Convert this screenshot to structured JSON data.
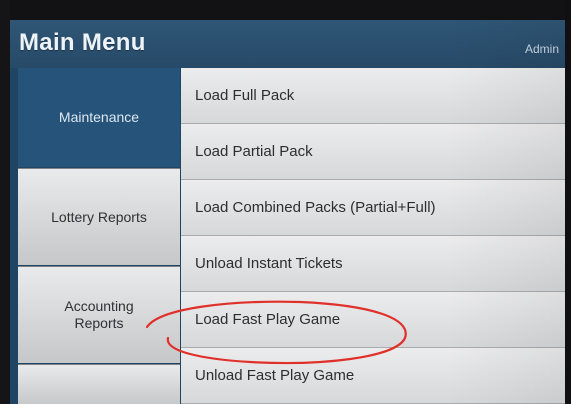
{
  "header": {
    "title": "Main Menu",
    "user": "Admin"
  },
  "sidebar": {
    "tabs": [
      {
        "label": "Maintenance",
        "active": true
      },
      {
        "label": "Lottery Reports",
        "active": false
      },
      {
        "label": "Accounting Reports",
        "active": false
      },
      {
        "label": "",
        "active": false
      }
    ]
  },
  "menu": {
    "items": [
      {
        "label": "Load Full Pack"
      },
      {
        "label": "Load Partial Pack"
      },
      {
        "label": "Load Combined Packs (Partial+Full)"
      },
      {
        "label": "Unload Instant Tickets"
      },
      {
        "label": "Load Fast Play Game",
        "circled": true
      },
      {
        "label": "Unload Fast Play Game"
      }
    ]
  },
  "colors": {
    "header_bg": "#2b5070",
    "sidebar_active": "#26537a",
    "annotation": "#e0302a"
  }
}
